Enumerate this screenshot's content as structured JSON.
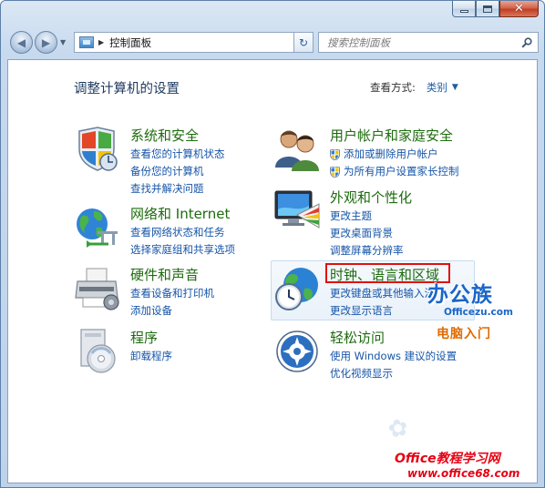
{
  "window": {
    "caption_buttons": {
      "minimize": "_",
      "maximize": "□",
      "close": "✕"
    }
  },
  "navbar": {
    "back_icon": "back-arrow-icon",
    "forward_icon": "forward-arrow-icon",
    "breadcrumb": "控制面板",
    "search_placeholder": "搜索控制面板"
  },
  "page": {
    "title": "调整计算机的设置",
    "view_by_label": "查看方式:",
    "view_by_value": "类别"
  },
  "categories": [
    {
      "title": "系统和安全",
      "icon": "shield-system-icon",
      "links": [
        "查看您的计算机状态",
        "备份您的计算机",
        "查找并解决问题"
      ]
    },
    {
      "title": "网络和 Internet",
      "icon": "network-globe-icon",
      "links": [
        "查看网络状态和任务",
        "选择家庭组和共享选项"
      ]
    },
    {
      "title": "硬件和声音",
      "icon": "printer-icon",
      "links": [
        "查看设备和打印机",
        "添加设备"
      ]
    },
    {
      "title": "程序",
      "icon": "programs-disc-icon",
      "links": [
        "卸载程序"
      ]
    },
    {
      "title": "用户帐户和家庭安全",
      "icon": "users-icon",
      "links": [
        "添加或删除用户帐户",
        "为所有用户设置家长控制"
      ]
    },
    {
      "title": "外观和个性化",
      "icon": "monitor-palette-icon",
      "links": [
        "更改主题",
        "更改桌面背景",
        "调整屏幕分辨率"
      ]
    },
    {
      "title": "时钟、语言和区域",
      "icon": "clock-globe-icon",
      "links": [
        "更改键盘或其他输入法",
        "更改显示语言"
      ]
    },
    {
      "title": "轻松访问",
      "icon": "ease-of-access-icon",
      "links": [
        "使用 Windows 建议的设置",
        "优化视频显示"
      ]
    }
  ],
  "watermarks": {
    "logo_main": "办公族",
    "logo_sub": "Officezu.com",
    "logo_tag": "电脑入门",
    "site_title": "Office教程学习网",
    "site_url": "www.office68.com"
  },
  "colors": {
    "category_title": "#1d6b0e",
    "link": "#1655a8",
    "highlight_border": "#e01010"
  }
}
